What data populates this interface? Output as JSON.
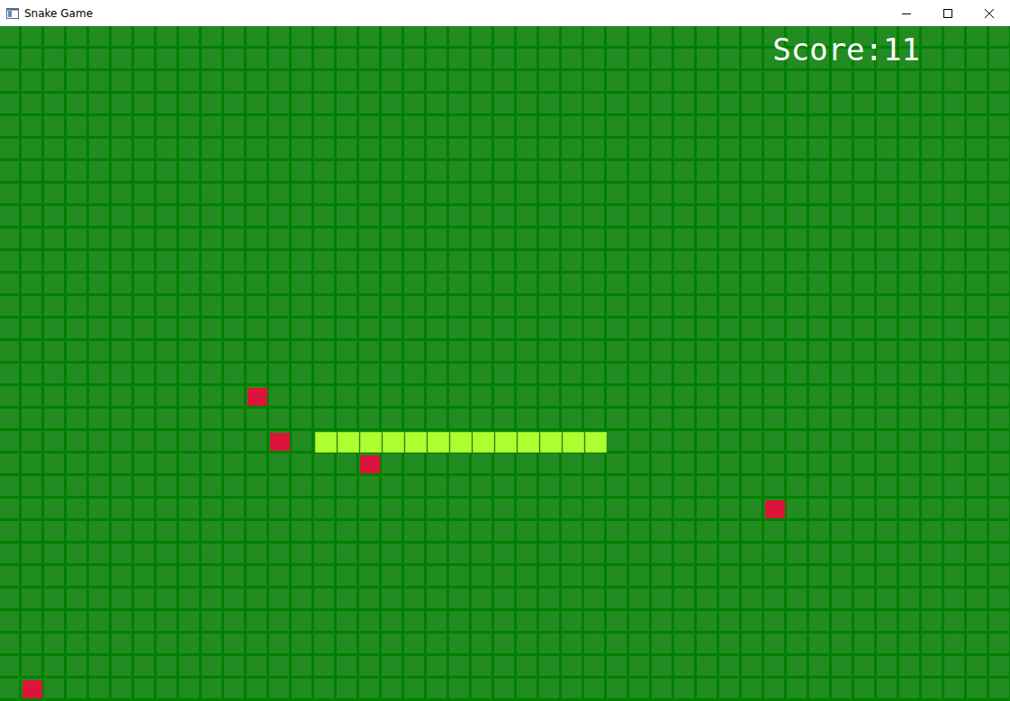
{
  "window": {
    "title": "Snake Game"
  },
  "score": {
    "label": "Score:",
    "value": "11"
  },
  "snake": {
    "segments": [
      {
        "col": 14,
        "row": 18
      },
      {
        "col": 15,
        "row": 18
      },
      {
        "col": 16,
        "row": 18
      },
      {
        "col": 17,
        "row": 18
      },
      {
        "col": 18,
        "row": 18
      },
      {
        "col": 19,
        "row": 18
      },
      {
        "col": 20,
        "row": 18
      },
      {
        "col": 21,
        "row": 18
      },
      {
        "col": 22,
        "row": 18
      },
      {
        "col": 23,
        "row": 18
      },
      {
        "col": 24,
        "row": 18
      },
      {
        "col": 25,
        "row": 18
      },
      {
        "col": 26,
        "row": 18
      }
    ]
  },
  "food": [
    {
      "col": 11,
      "row": 16
    },
    {
      "col": 12,
      "row": 18
    },
    {
      "col": 16,
      "row": 19
    },
    {
      "col": 34,
      "row": 21
    },
    {
      "col": 1,
      "row": 29
    }
  ]
}
